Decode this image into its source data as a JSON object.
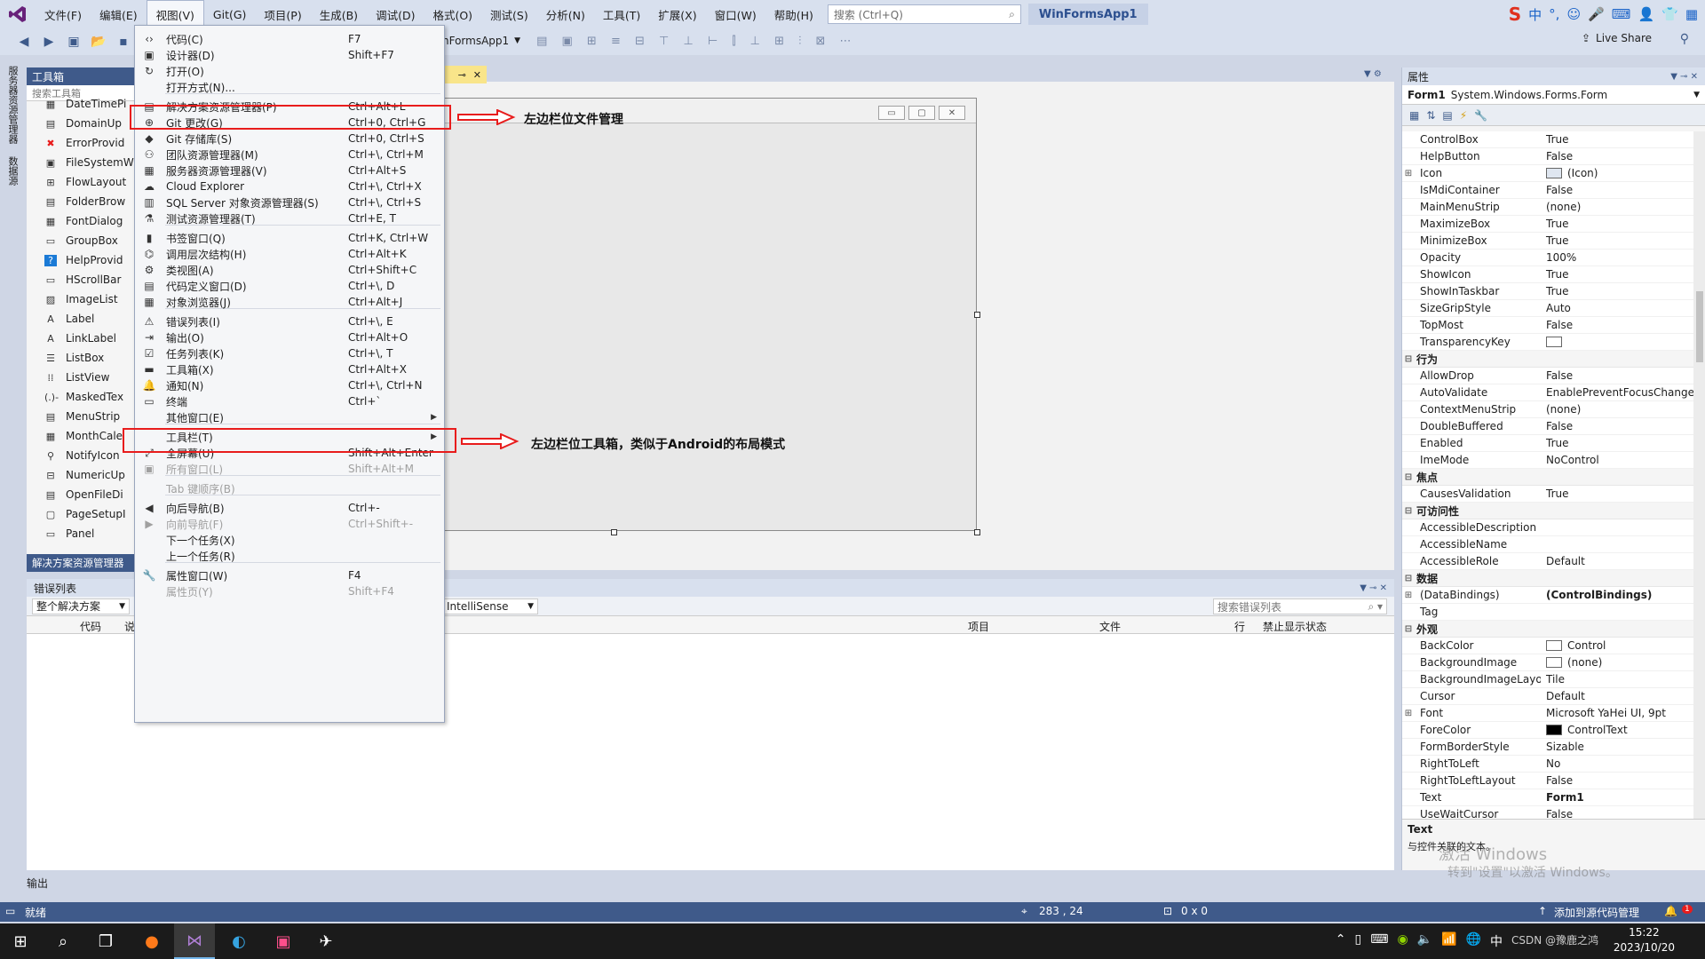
{
  "menubar": {
    "items": [
      "文件(F)",
      "编辑(E)",
      "视图(V)",
      "Git(G)",
      "项目(P)",
      "生成(B)",
      "调试(D)",
      "格式(O)",
      "测试(S)",
      "分析(N)",
      "工具(T)",
      "扩展(X)",
      "窗口(W)",
      "帮助(H)"
    ],
    "search_placeholder": "搜索 (Ctrl+Q)",
    "app_title": "WinFormsApp1"
  },
  "toolbar": {
    "project_combo": "nFormsApp1",
    "liveshare": "Live Share"
  },
  "left_strip": {
    "tab1": "服务器资源管理器",
    "tab2": "数据源"
  },
  "toolbox": {
    "title": "工具箱",
    "search_placeholder": "搜索工具箱",
    "items": [
      {
        "icon": "datetimepicker-icon",
        "label": "DateTimePi"
      },
      {
        "icon": "domainupdown-icon",
        "label": "DomainUp"
      },
      {
        "icon": "errorprovider-icon",
        "label": "ErrorProvid"
      },
      {
        "icon": "filesystemwatcher-icon",
        "label": "FileSystemW"
      },
      {
        "icon": "flowlayout-icon",
        "label": "FlowLayout"
      },
      {
        "icon": "folderbrowser-icon",
        "label": "FolderBrow"
      },
      {
        "icon": "fontdialog-icon",
        "label": "FontDialog"
      },
      {
        "icon": "groupbox-icon",
        "label": "GroupBox"
      },
      {
        "icon": "helpprovider-icon",
        "label": "HelpProvid"
      },
      {
        "icon": "hscrollbar-icon",
        "label": "HScrollBar"
      },
      {
        "icon": "imagelist-icon",
        "label": "ImageList"
      },
      {
        "icon": "label-icon",
        "label": "Label"
      },
      {
        "icon": "linklabel-icon",
        "label": "LinkLabel"
      },
      {
        "icon": "listbox-icon",
        "label": "ListBox"
      },
      {
        "icon": "listview-icon",
        "label": "ListView"
      },
      {
        "icon": "maskedtextbox-icon",
        "label": "MaskedTex"
      },
      {
        "icon": "menustrip-icon",
        "label": "MenuStrip"
      },
      {
        "icon": "monthcalendar-icon",
        "label": "MonthCale"
      },
      {
        "icon": "notifyicon-icon",
        "label": "NotifyIcon"
      },
      {
        "icon": "numericupdown-icon",
        "label": "NumericUp"
      },
      {
        "icon": "openfiledialog-icon",
        "label": "OpenFileDi"
      },
      {
        "icon": "pagesetup-icon",
        "label": "PageSetupI"
      },
      {
        "icon": "panel-icon",
        "label": "Panel"
      }
    ],
    "solution_tab": "解决方案资源管理器"
  },
  "view_menu": {
    "items": [
      {
        "label": "代码(C)",
        "shortcut": "F7",
        "icon": "code-icon"
      },
      {
        "label": "设计器(D)",
        "shortcut": "Shift+F7",
        "icon": "designer-icon"
      },
      {
        "label": "打开(O)",
        "shortcut": "",
        "icon": "open-icon"
      },
      {
        "label": "打开方式(N)...",
        "shortcut": "",
        "icon": ""
      },
      {
        "label": "解决方案资源管理器(P)",
        "shortcut": "Ctrl+Alt+L",
        "icon": "solution-explorer-icon"
      },
      {
        "label": "Git 更改(G)",
        "shortcut": "Ctrl+0, Ctrl+G",
        "icon": "git-changes-icon"
      },
      {
        "label": "Git 存储库(S)",
        "shortcut": "Ctrl+0, Ctrl+S",
        "icon": "git-repo-icon"
      },
      {
        "label": "团队资源管理器(M)",
        "shortcut": "Ctrl+\\, Ctrl+M",
        "icon": "team-explorer-icon"
      },
      {
        "label": "服务器资源管理器(V)",
        "shortcut": "Ctrl+Alt+S",
        "icon": "server-explorer-icon"
      },
      {
        "label": "Cloud Explorer",
        "shortcut": "Ctrl+\\, Ctrl+X",
        "icon": "cloud-icon"
      },
      {
        "label": "SQL Server 对象资源管理器(S)",
        "shortcut": "Ctrl+\\, Ctrl+S",
        "icon": "sql-server-icon"
      },
      {
        "label": "测试资源管理器(T)",
        "shortcut": "Ctrl+E, T",
        "icon": "test-explorer-icon"
      },
      {
        "label": "书签窗口(Q)",
        "shortcut": "Ctrl+K, Ctrl+W",
        "icon": "bookmark-icon"
      },
      {
        "label": "调用层次结构(H)",
        "shortcut": "Ctrl+Alt+K",
        "icon": "call-hierarchy-icon"
      },
      {
        "label": "类视图(A)",
        "shortcut": "Ctrl+Shift+C",
        "icon": "class-view-icon"
      },
      {
        "label": "代码定义窗口(D)",
        "shortcut": "Ctrl+\\, D",
        "icon": "code-definition-icon"
      },
      {
        "label": "对象浏览器(J)",
        "shortcut": "Ctrl+Alt+J",
        "icon": "object-browser-icon"
      },
      {
        "label": "错误列表(I)",
        "shortcut": "Ctrl+\\, E",
        "icon": "error-list-icon"
      },
      {
        "label": "输出(O)",
        "shortcut": "Ctrl+Alt+O",
        "icon": "output-icon"
      },
      {
        "label": "任务列表(K)",
        "shortcut": "Ctrl+\\, T",
        "icon": "task-list-icon"
      },
      {
        "label": "工具箱(X)",
        "shortcut": "Ctrl+Alt+X",
        "icon": "toolbox-icon"
      },
      {
        "label": "通知(N)",
        "shortcut": "Ctrl+\\, Ctrl+N",
        "icon": "notification-icon"
      },
      {
        "label": "终端",
        "shortcut": "Ctrl+`",
        "icon": "terminal-icon"
      },
      {
        "label": "其他窗口(E)",
        "shortcut": "",
        "icon": ""
      },
      {
        "label": "工具栏(T)",
        "shortcut": "",
        "icon": ""
      },
      {
        "label": "全屏幕(U)",
        "shortcut": "Shift+Alt+Enter",
        "icon": "fullscreen-icon"
      },
      {
        "label": "所有窗口(L)",
        "shortcut": "Shift+Alt+M",
        "icon": "all-windows-icon"
      },
      {
        "label": "Tab 键顺序(B)",
        "shortcut": "",
        "icon": ""
      },
      {
        "label": "向后导航(B)",
        "shortcut": "Ctrl+-",
        "icon": "navigate-back-icon"
      },
      {
        "label": "向前导航(F)",
        "shortcut": "Ctrl+Shift+-",
        "icon": "navigate-forward-icon"
      },
      {
        "label": "下一个任务(X)",
        "shortcut": "",
        "icon": ""
      },
      {
        "label": "上一个任务(R)",
        "shortcut": "",
        "icon": ""
      },
      {
        "label": "属性窗口(W)",
        "shortcut": "F4",
        "icon": "properties-wrench-icon"
      },
      {
        "label": "属性页(Y)",
        "shortcut": "Shift+F4",
        "icon": ""
      }
    ]
  },
  "annotations": {
    "solution_explorer": "左边栏位文件管理",
    "toolbox": "左边栏位工具箱，类似于Android的布局模式"
  },
  "properties": {
    "title": "属性",
    "object_name": "Form1",
    "object_type": "System.Windows.Forms.Form",
    "rows": [
      {
        "kind": "prop",
        "name": "ControlBox",
        "value": "True"
      },
      {
        "kind": "prop",
        "name": "HelpButton",
        "value": "False"
      },
      {
        "kind": "prop",
        "name": "Icon",
        "value": "(Icon)",
        "expandable": true,
        "swatch": "icon"
      },
      {
        "kind": "prop",
        "name": "IsMdiContainer",
        "value": "False"
      },
      {
        "kind": "prop",
        "name": "MainMenuStrip",
        "value": "(none)"
      },
      {
        "kind": "prop",
        "name": "MaximizeBox",
        "value": "True"
      },
      {
        "kind": "prop",
        "name": "MinimizeBox",
        "value": "True"
      },
      {
        "kind": "prop",
        "name": "Opacity",
        "value": "100%"
      },
      {
        "kind": "prop",
        "name": "ShowIcon",
        "value": "True"
      },
      {
        "kind": "prop",
        "name": "ShowInTaskbar",
        "value": "True"
      },
      {
        "kind": "prop",
        "name": "SizeGripStyle",
        "value": "Auto"
      },
      {
        "kind": "prop",
        "name": "TopMost",
        "value": "False"
      },
      {
        "kind": "prop",
        "name": "TransparencyKey",
        "value": "",
        "swatch": "#ffffff"
      },
      {
        "kind": "cat",
        "name": "行为"
      },
      {
        "kind": "prop",
        "name": "AllowDrop",
        "value": "False"
      },
      {
        "kind": "prop",
        "name": "AutoValidate",
        "value": "EnablePreventFocusChange"
      },
      {
        "kind": "prop",
        "name": "ContextMenuStrip",
        "value": "(none)"
      },
      {
        "kind": "prop",
        "name": "DoubleBuffered",
        "value": "False"
      },
      {
        "kind": "prop",
        "name": "Enabled",
        "value": "True"
      },
      {
        "kind": "prop",
        "name": "ImeMode",
        "value": "NoControl"
      },
      {
        "kind": "cat",
        "name": "焦点"
      },
      {
        "kind": "prop",
        "name": "CausesValidation",
        "value": "True"
      },
      {
        "kind": "cat",
        "name": "可访问性"
      },
      {
        "kind": "prop",
        "name": "AccessibleDescription",
        "value": ""
      },
      {
        "kind": "prop",
        "name": "AccessibleName",
        "value": ""
      },
      {
        "kind": "prop",
        "name": "AccessibleRole",
        "value": "Default"
      },
      {
        "kind": "cat",
        "name": "数据"
      },
      {
        "kind": "prop",
        "name": "(DataBindings)",
        "value": "(ControlBindings)",
        "expandable": true,
        "bold": true
      },
      {
        "kind": "prop",
        "name": "Tag",
        "value": ""
      },
      {
        "kind": "cat",
        "name": "外观"
      },
      {
        "kind": "prop",
        "name": "BackColor",
        "value": "Control",
        "swatch": "#ffffff"
      },
      {
        "kind": "prop",
        "name": "BackgroundImage",
        "value": "(none)",
        "swatch": "#ffffff"
      },
      {
        "kind": "prop",
        "name": "BackgroundImageLayout",
        "value": "Tile"
      },
      {
        "kind": "prop",
        "name": "Cursor",
        "value": "Default"
      },
      {
        "kind": "prop",
        "name": "Font",
        "value": "Microsoft YaHei UI, 9pt",
        "expandable": true
      },
      {
        "kind": "prop",
        "name": "ForeColor",
        "value": "ControlText",
        "swatch": "#000000"
      },
      {
        "kind": "prop",
        "name": "FormBorderStyle",
        "value": "Sizable"
      },
      {
        "kind": "prop",
        "name": "RightToLeft",
        "value": "No"
      },
      {
        "kind": "prop",
        "name": "RightToLeftLayout",
        "value": "False"
      },
      {
        "kind": "prop",
        "name": "Text",
        "value": "Form1",
        "bold": true
      },
      {
        "kind": "prop",
        "name": "UseWaitCursor",
        "value": "False"
      }
    ],
    "desc_title": "Text",
    "desc_text": "与控件关联的文本。",
    "watermark": "激活 Windows",
    "watermark_sub": "转到\"设置\"以激活 Windows。"
  },
  "error_list": {
    "title": "错误列表",
    "scope": "整个解决方案",
    "source": "IntelliSense",
    "search_placeholder": "搜索错误列表",
    "columns": [
      "代码",
      "说",
      "项目",
      "文件",
      "行",
      "禁止显示状态"
    ]
  },
  "output_tab": "输出",
  "statusbar": {
    "ready": "就绪",
    "position": "283 , 24",
    "size": "0 x 0",
    "source_control": "添加到源代码管理",
    "notif_count": "1"
  },
  "taskbar": {
    "time": "15:22",
    "date": "2023/10/20",
    "ime": "中",
    "csdn": "CSDN @豫鹿之鸿"
  },
  "colors": {
    "accent": "#3f5a8a",
    "highlight": "#e81c1c",
    "tab_active": "#f9e58a"
  }
}
